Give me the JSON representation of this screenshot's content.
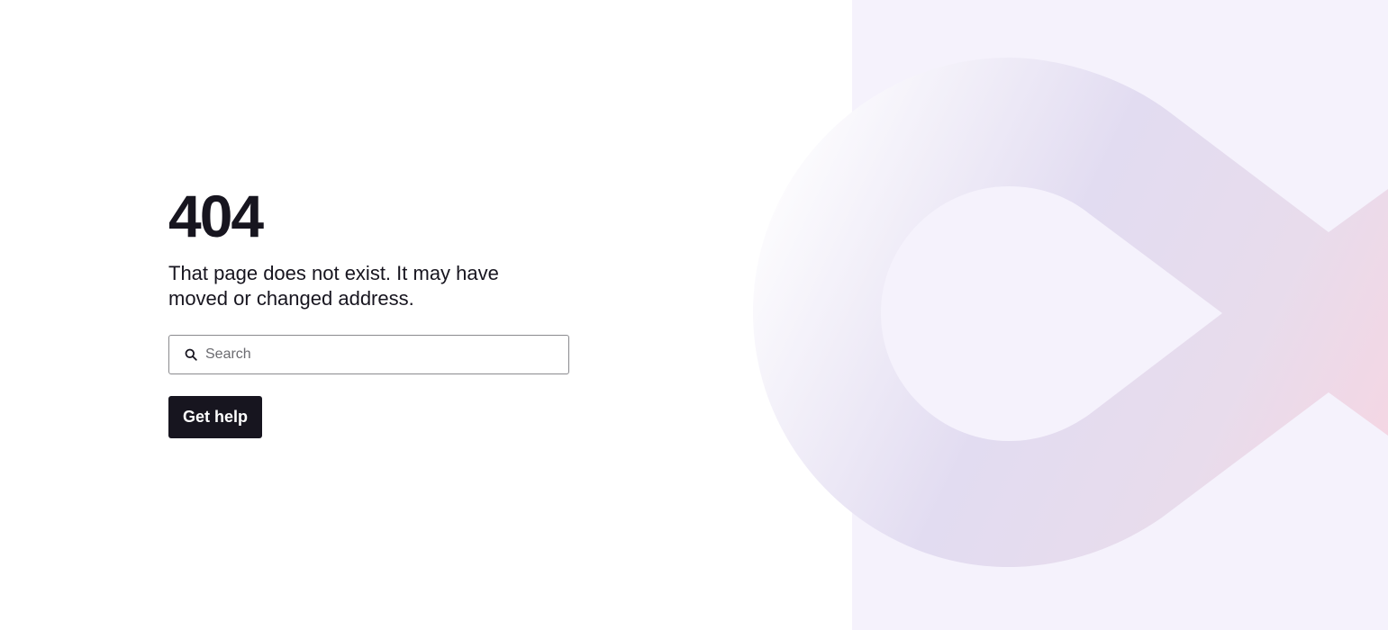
{
  "error": {
    "code": "404",
    "message": "That page does not exist. It may have moved or changed address."
  },
  "search": {
    "placeholder": "Search",
    "value": "",
    "icon": "search-icon"
  },
  "actions": {
    "get_help_label": "Get help"
  },
  "colors": {
    "text": "#17151f",
    "button_bg": "#17151f",
    "button_text": "#ffffff",
    "panel_bg": "#f5f2fc",
    "decor_lavender": "#dcd6ee",
    "decor_pink": "#f2d2e2"
  }
}
